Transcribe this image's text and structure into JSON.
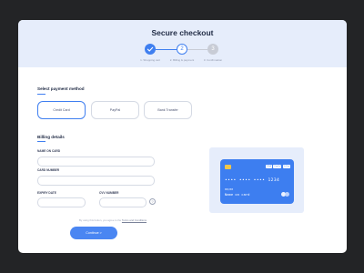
{
  "header": {
    "title": "Secure checkout",
    "steps": [
      {
        "icon": "check-icon",
        "label": "1. Shopping cart",
        "state": "done"
      },
      {
        "number": "2",
        "label": "2. Billing & payment",
        "state": "current"
      },
      {
        "number": "3",
        "label": "3. Confirmation",
        "state": "upcoming"
      }
    ]
  },
  "payment": {
    "heading": "Select payment method",
    "methods": [
      "Credit Card",
      "PayPal",
      "Bank Transfer"
    ],
    "selected": "Credit Card"
  },
  "billing": {
    "heading": "Billing details",
    "name_label": "NAME ON CARD",
    "number_label": "CARD NUMBER",
    "expiry_label": "EXPIRY DATE",
    "cvv_label": "CVV NUMBER",
    "info_glyph": "?",
    "terms_prefix": "By using this button, you agree to the",
    "terms_link": "Terms and Conditions",
    "continue_label": "Continue >"
  },
  "card": {
    "brands": [
      "VISA",
      "PayPal",
      "G Pay"
    ],
    "number": "•••• •••• •••• 1234",
    "expiry": "00/00",
    "name": "Name on card"
  },
  "colors": {
    "accent": "#3f7ff0",
    "header_bg": "#e6edfb",
    "card_bg": "#3d7ef0",
    "frame_bg": "#232426"
  }
}
